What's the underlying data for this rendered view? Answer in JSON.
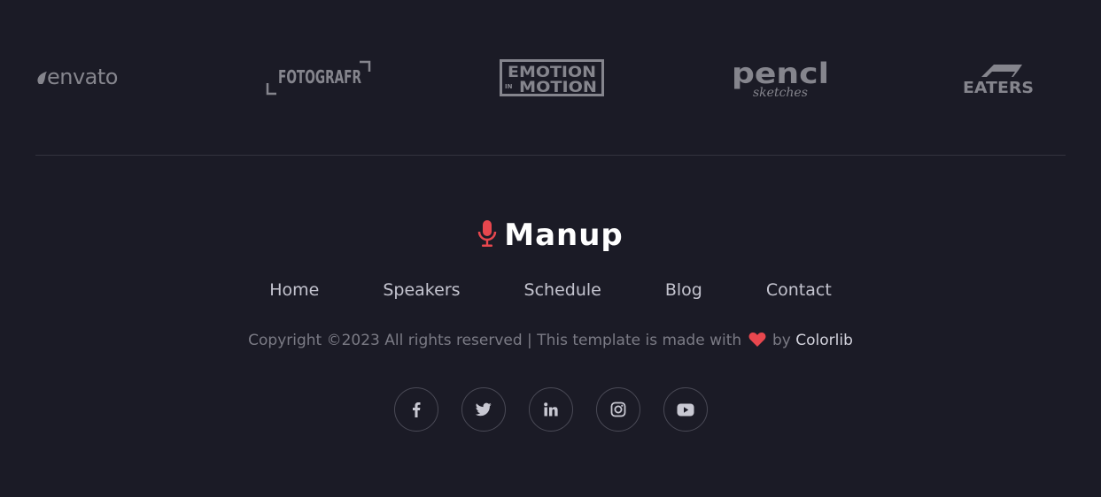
{
  "partners": {
    "logos": [
      {
        "name": "envato",
        "text": "envato"
      },
      {
        "name": "fotografr",
        "text": "FOTOGRAFR"
      },
      {
        "name": "emotion-in-motion",
        "text_top": "EMOTION",
        "text_in": "IN",
        "text_bottom": "MOTION"
      },
      {
        "name": "pencil",
        "text": "pencl",
        "subtext": "sketches"
      },
      {
        "name": "eaters",
        "text": "EATERS"
      }
    ]
  },
  "brand": {
    "name": "Manup",
    "icon": "microphone-icon",
    "icon_color": "#e8474e"
  },
  "nav": {
    "items": [
      {
        "label": "Home"
      },
      {
        "label": "Speakers"
      },
      {
        "label": "Schedule"
      },
      {
        "label": "Blog"
      },
      {
        "label": "Contact"
      }
    ]
  },
  "copyright": {
    "prefix": "Copyright ©2023 All rights reserved | This template is made with",
    "heart_icon": "heart-icon",
    "heart_color": "#e8474e",
    "by_text": "by",
    "link_text": "Colorlib"
  },
  "social": {
    "items": [
      {
        "icon": "facebook-icon"
      },
      {
        "icon": "twitter-icon"
      },
      {
        "icon": "linkedin-icon"
      },
      {
        "icon": "instagram-icon"
      },
      {
        "icon": "youtube-icon"
      }
    ]
  },
  "colors": {
    "background": "#1b1b26",
    "logo_gray": "#85858d",
    "nav_text": "#c4c4cf",
    "muted_text": "#7b7b85",
    "accent": "#e8474e"
  }
}
